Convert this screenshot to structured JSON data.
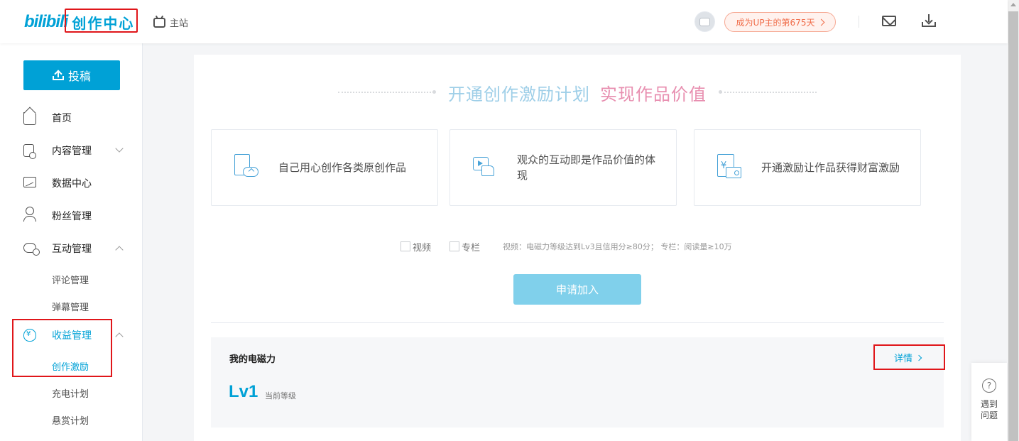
{
  "header": {
    "logo_text": "bilibili",
    "brand": "创作中心",
    "home_link": "主站",
    "up_badge": "成为UP主的第675天"
  },
  "sidebar": {
    "upload_label": "投稿",
    "items": [
      {
        "label": "首页",
        "icon": "home-icon"
      },
      {
        "label": "内容管理",
        "icon": "content-icon"
      },
      {
        "label": "数据中心",
        "icon": "data-chart-icon"
      },
      {
        "label": "粉丝管理",
        "icon": "fans-icon"
      },
      {
        "label": "互动管理",
        "icon": "interaction-icon"
      },
      {
        "label": "收益管理",
        "icon": "income-icon"
      }
    ],
    "interaction_sub": [
      "评论管理",
      "弹幕管理"
    ],
    "income_sub": [
      "创作激励",
      "充电计划",
      "悬赏计划"
    ]
  },
  "main": {
    "title_part1": "开通创作激励计划",
    "title_part2": "实现作品价值",
    "features": [
      {
        "text": "自己用心创作各类原创作品",
        "icon": "upload-file-icon"
      },
      {
        "text": "观众的互动即是作品价值的体现",
        "icon": "tv-like-icon"
      },
      {
        "text": "开通激励让作品获得财富激励",
        "icon": "money-wallet-icon"
      }
    ],
    "options": {
      "video": "视频",
      "column": "专栏",
      "note": "视频：电磁力等级达到Lv3且信用分≥80分； 专栏：阅读量≥10万"
    },
    "apply_button": "申请加入",
    "power": {
      "title": "我的电磁力",
      "detail": "详情",
      "level": "Lv1",
      "level_sub": "当前等级"
    }
  },
  "help": {
    "icon": "?",
    "label": "遇到问题"
  },
  "colors": {
    "brand": "#00a1d6",
    "highlight_box": "#e0161a",
    "badge": "#f06c49"
  }
}
